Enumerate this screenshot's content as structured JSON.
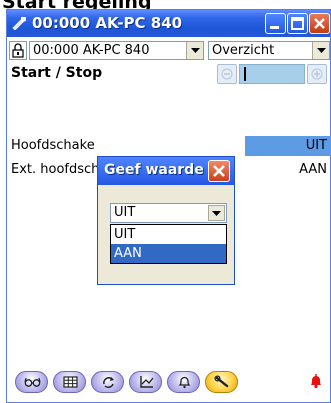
{
  "page_title": "Start regeling",
  "window": {
    "title": "00:000 AK-PC 840",
    "app_icon": "tool-icon",
    "buttons": [
      "minimize-icon",
      "maximize-icon",
      "close-icon"
    ]
  },
  "toolbar": {
    "lock_icon": "lock-icon",
    "device_select": "00:000 AK-PC 840",
    "view_select": "Overzicht"
  },
  "section": {
    "title": "Start / Stop"
  },
  "params": [
    {
      "label": "Hoofdschake",
      "value": "UIT"
    },
    {
      "label": "Ext. hoofdschakelaar",
      "value": "AAN"
    }
  ],
  "dialog": {
    "title": "Geef waarde",
    "selected": "UIT",
    "options": [
      "UIT",
      "AAN"
    ],
    "highlighted": "AAN"
  },
  "bottom_icons": [
    "glasses-icon",
    "grid-icon",
    "refresh-icon",
    "chart-icon",
    "bell-icon",
    "wrench-icon"
  ],
  "active_bottom_icon": "wrench-icon",
  "alarm_icon": "alarm-bell-icon",
  "colors": {
    "titlebar": "#2458e4",
    "selection": "#316ac5",
    "value_highlight": "#5d9be5",
    "alarm": "#ff0000"
  }
}
